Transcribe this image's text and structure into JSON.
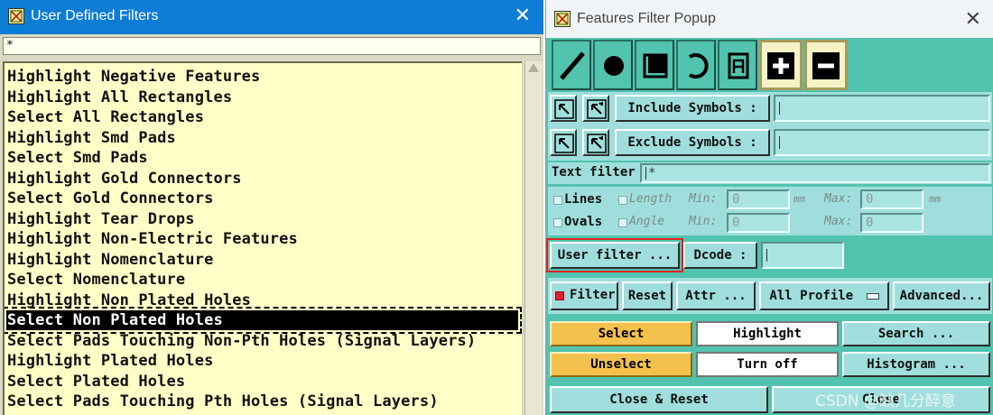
{
  "left_window": {
    "title": "User Defined Filters",
    "close_glyph": "✕",
    "filter_value": "*",
    "items": [
      "Highlight Negative Features",
      "Highlight All Rectangles",
      "Select All Rectangles",
      "Highlight Smd Pads",
      "Select Smd Pads",
      "Highlight Gold Connectors",
      "Select Gold Connectors",
      "Highlight Tear Drops",
      "Highlight Non-Electric Features",
      "Highlight Nomenclature",
      "Select Nomenclature",
      "Highlight Non Plated Holes",
      "Select Non Plated Holes",
      "Select Pads Touching Non-Pth Holes (Signal Layers)",
      "Highlight Plated Holes",
      "Select Plated Holes",
      "Select Pads Touching Pth Holes (Signal Layers)"
    ],
    "selected_item": "Select Non Plated Holes"
  },
  "right_window": {
    "title": "Features Filter Popup",
    "close_glyph": "✕",
    "tools": [
      "line-tool-icon",
      "pad-tool-icon",
      "surface-tool-icon",
      "arc-tool-icon",
      "text-tool-icon",
      "plus-icon",
      "minus-icon"
    ],
    "include_symbols_label": "Include Symbols :",
    "include_symbols_value": "",
    "exclude_symbols_label": "Exclude Symbols :",
    "exclude_symbols_value": "",
    "text_filter_label": "Text filter",
    "text_filter_value": "*",
    "lines_label": "Lines",
    "ovals_label": "Ovals",
    "length_label": "Length",
    "angle_label": "Angle",
    "min_label": "Min:",
    "max_label": "Max:",
    "length_min": "0",
    "length_max": "0",
    "length_unit": "mm",
    "angle_min": "0",
    "angle_max": "0",
    "user_filter_label": "User filter ...",
    "dcode_label": "Dcode :",
    "dcode_value": "",
    "filter_label": "Filter",
    "filter_checked": true,
    "reset_label": "Reset",
    "attr_label": "Attr ...",
    "profile_label": "All Profile",
    "advanced_label": "Advanced...",
    "select_label": "Select",
    "highlight_label": "Highlight",
    "search_label": "Search ...",
    "unselect_label": "Unselect",
    "turn_off_label": "Turn off",
    "histogram_label": "Histogram ...",
    "close_reset_label": "Close & Reset",
    "close_label": "Close"
  },
  "watermark": "CSDN @缺几分醉意",
  "colors": {
    "titlebar_active": "#0c7cd5",
    "list_bg": "#ffffc8",
    "panel_teal": "#52c3ae",
    "control_bg": "#9fdedc",
    "yellow_button": "#f4c04e",
    "highlight_red": "#e02020"
  }
}
